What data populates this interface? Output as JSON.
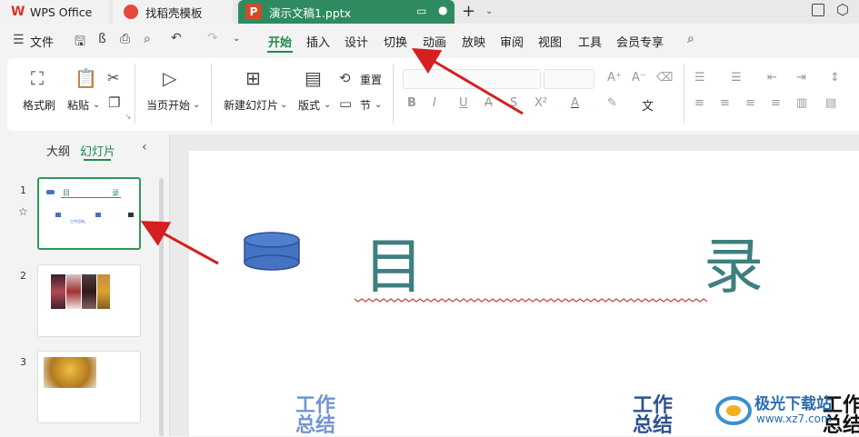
{
  "tabs": {
    "wps": "WPS Office",
    "template": "找稻壳模板",
    "document": "演示文稿1.pptx"
  },
  "menu": {
    "file": "文件",
    "items": [
      "开始",
      "插入",
      "设计",
      "切换",
      "动画",
      "放映",
      "审阅",
      "视图",
      "工具",
      "会员专享"
    ]
  },
  "ribbon": {
    "format_painter": "格式刷",
    "paste": "粘贴",
    "play_from_current": "当页开始",
    "new_slide": "新建幻灯片",
    "layout": "版式",
    "reset": "重置",
    "section": "节"
  },
  "sidebar": {
    "tab_outline": "大纲",
    "tab_slides": "幻灯片",
    "slide_numbers": [
      "1",
      "2",
      "3"
    ],
    "thumb1_title_left": "目",
    "thumb1_title_right": "录",
    "thumb1_text": "工作总结。"
  },
  "slide": {
    "title_left": "目",
    "title_right": "录",
    "item1": "工作\n总结",
    "item2": "工作\n总结",
    "item3": "工作\n总结"
  },
  "watermark": {
    "text": "极光下载站",
    "url": "www.xz7.com"
  },
  "colors": {
    "accent": "#2e8b60",
    "title_teal": "#3f7f7f",
    "shape_blue": "#4472c4",
    "arrow_red": "#d42020"
  }
}
